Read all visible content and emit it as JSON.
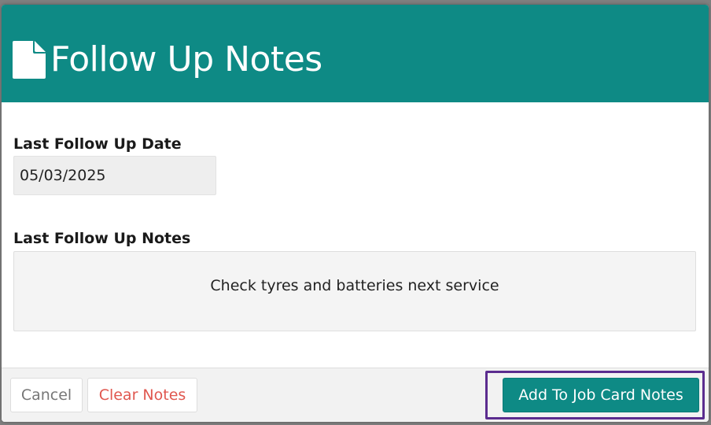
{
  "modal": {
    "title": "Follow Up Notes",
    "icon": "document-icon",
    "header_color": "#0e8a85"
  },
  "fields": {
    "last_follow_up_date": {
      "label": "Last Follow Up Date",
      "value": "05/03/2025"
    },
    "last_follow_up_notes": {
      "label": "Last Follow Up Notes",
      "value": "Check tyres and batteries next service"
    }
  },
  "footer": {
    "cancel_label": "Cancel",
    "clear_label": "Clear Notes",
    "add_label": "Add To Job Card Notes",
    "clear_color": "#e0574f",
    "focus_ring_color": "#5b2c8f"
  }
}
